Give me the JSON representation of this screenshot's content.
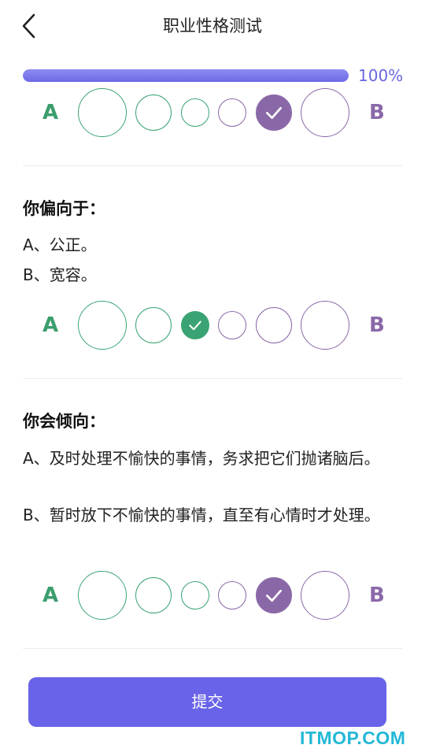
{
  "header": {
    "title": "职业性格测试",
    "back_icon": "chevron-left-icon"
  },
  "progress": {
    "value_percent": 100,
    "text": "100%"
  },
  "scale": {
    "label_a": "A",
    "label_b": "B",
    "colors": {
      "a_side": "#3aa373",
      "b_side": "#8a68a8"
    }
  },
  "questions": [
    {
      "title": "",
      "options": [],
      "selected_index": 4
    },
    {
      "title": "你偏向于：",
      "options": [
        "A、公正。",
        "B、宽容。"
      ],
      "selected_index": 2
    },
    {
      "title": "你会倾向：",
      "options": [
        "A、及时处理不愉快的事情，务求把它们抛诸脑后。",
        "B、暂时放下不愉快的事情，直至有心情时才处理。"
      ],
      "selected_index": 4
    }
  ],
  "submit": {
    "label": "提交",
    "color": "#6863e8"
  },
  "watermark": {
    "text": "ITMOP.COM"
  }
}
